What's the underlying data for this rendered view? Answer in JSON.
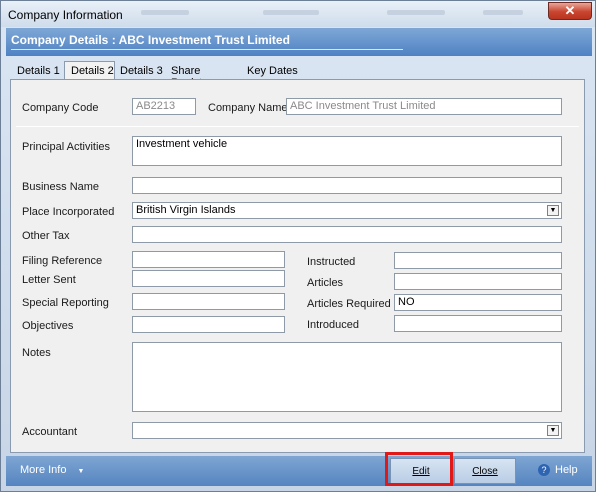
{
  "window": {
    "title": "Company Information",
    "close_glyph": "✕"
  },
  "banner": {
    "text": "Company Details  : ABC Investment Trust Limited"
  },
  "tabs": [
    {
      "label": "Details 1"
    },
    {
      "label": "Details 2"
    },
    {
      "label": "Details 3"
    },
    {
      "label": "Share Register"
    },
    {
      "label": "Key Dates"
    }
  ],
  "form": {
    "company_code": {
      "label": "Company Code",
      "value": "AB2213"
    },
    "company_name": {
      "label": "Company Name",
      "value": "ABC Investment Trust Limited"
    },
    "principal_activities": {
      "label": "Principal Activities",
      "value": "Investment vehicle"
    },
    "business_name": {
      "label": "Business Name",
      "value": ""
    },
    "place_incorporated": {
      "label": "Place Incorporated",
      "value": "British Virgin Islands"
    },
    "other_tax": {
      "label": "Other Tax",
      "value": ""
    },
    "filing_reference": {
      "label": "Filing Reference",
      "value": ""
    },
    "letter_sent": {
      "label": "Letter Sent",
      "value": ""
    },
    "special_reporting": {
      "label": "Special Reporting",
      "value": ""
    },
    "objectives": {
      "label": "Objectives",
      "value": ""
    },
    "instructed": {
      "label": "Instructed",
      "value": ""
    },
    "articles": {
      "label": "Articles",
      "value": ""
    },
    "articles_required": {
      "label": "Articles Required",
      "value": "NO"
    },
    "introduced": {
      "label": "Introduced",
      "value": ""
    },
    "notes": {
      "label": "Notes",
      "value": ""
    },
    "accountant": {
      "label": "Accountant",
      "value": ""
    }
  },
  "footer": {
    "more_info": "More Info",
    "edit": "Edit",
    "close": "Close",
    "help": "Help"
  },
  "colors": {
    "banner": "#4f82c3",
    "highlight": "#e01818"
  }
}
